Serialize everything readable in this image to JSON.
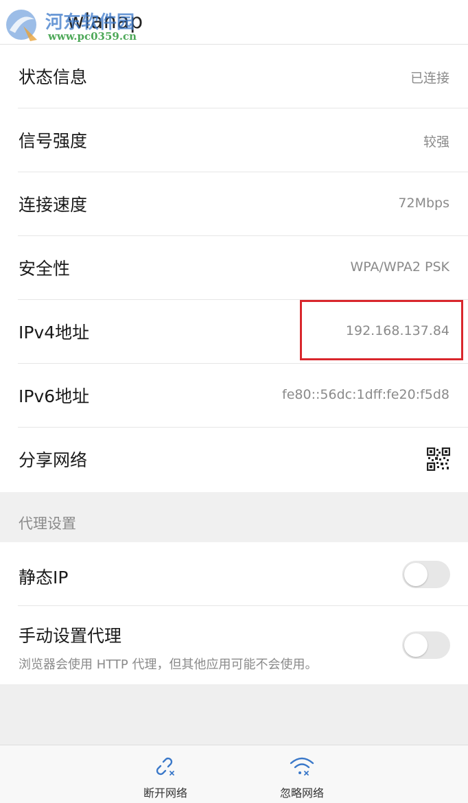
{
  "header": {
    "title": "wlanap"
  },
  "watermark": {
    "name": "河东软件园",
    "url": "www.pc0359.cn"
  },
  "info_rows": [
    {
      "label": "状态信息",
      "value": "已连接"
    },
    {
      "label": "信号强度",
      "value": "较强"
    },
    {
      "label": "连接速度",
      "value": "72Mbps"
    },
    {
      "label": "安全性",
      "value": "WPA/WPA2 PSK"
    },
    {
      "label": "IPv4地址",
      "value": "192.168.137.84"
    },
    {
      "label": "IPv6地址",
      "value": "fe80::56dc:1dff:fe20:f5d8"
    },
    {
      "label": "分享网络",
      "icon": "qr-code-icon"
    }
  ],
  "proxy": {
    "section_title": "代理设置",
    "static_ip": {
      "label": "静态IP",
      "enabled": false
    },
    "manual_proxy": {
      "label": "手动设置代理",
      "desc": "浏览器会使用 HTTP 代理，但其他应用可能不会使用。",
      "enabled": false
    }
  },
  "bottom_bar": {
    "disconnect": {
      "label": "断开网络",
      "icon": "broken-link-icon"
    },
    "forget": {
      "label": "忽略网络",
      "icon": "wifi-off-icon"
    }
  },
  "colors": {
    "accent": "#3a78c9",
    "highlight": "#d9262c",
    "toggle_off": "#e7e7e7"
  }
}
